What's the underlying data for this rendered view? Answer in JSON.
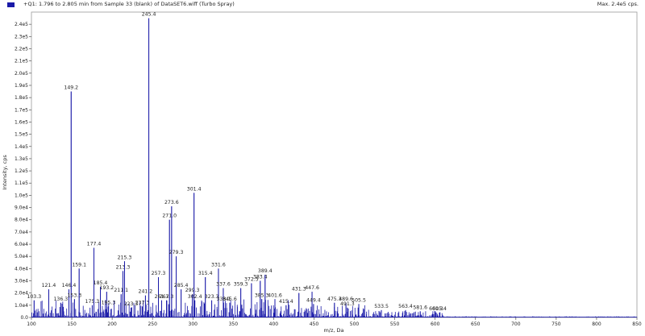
{
  "header": {
    "title": "+Q1: 1.796 to 2.805 min from Sample 33 (blank) of DataSET6.wiff (Turbo Spray)",
    "max_label": "Max. 2.4e5 cps.",
    "series_color": "#1a1aa8"
  },
  "chart_data": {
    "type": "line",
    "title": "+Q1: 1.796 to 2.805 min from Sample 33 (blank) of DataSET6.wiff (Turbo Spray)",
    "xlabel": "m/z, Da",
    "ylabel": "Intensity, cps",
    "xlim": [
      100,
      850
    ],
    "ylim": [
      0,
      250000
    ],
    "grid": false,
    "x_ticks": [
      "100",
      "150",
      "200",
      "250",
      "300",
      "350",
      "400",
      "450",
      "500",
      "550",
      "600",
      "650",
      "700",
      "750",
      "800",
      "850"
    ],
    "y_ticks": [
      {
        "value": 0,
        "label": "0.0"
      },
      {
        "value": 10000,
        "label": "1.0e4"
      },
      {
        "value": 20000,
        "label": "2.0e4"
      },
      {
        "value": 30000,
        "label": "3.0e4"
      },
      {
        "value": 40000,
        "label": "4.0e4"
      },
      {
        "value": 50000,
        "label": "5.0e4"
      },
      {
        "value": 60000,
        "label": "6.0e4"
      },
      {
        "value": 70000,
        "label": "7.0e4"
      },
      {
        "value": 80000,
        "label": "8.0e4"
      },
      {
        "value": 90000,
        "label": "9.0e4"
      },
      {
        "value": 100000,
        "label": "1.0e5"
      },
      {
        "value": 110000,
        "label": "1.1e5"
      },
      {
        "value": 120000,
        "label": "1.2e5"
      },
      {
        "value": 130000,
        "label": "1.3e5"
      },
      {
        "value": 140000,
        "label": "1.4e5"
      },
      {
        "value": 150000,
        "label": "1.5e5"
      },
      {
        "value": 160000,
        "label": "1.6e5"
      },
      {
        "value": 170000,
        "label": "1.7e5"
      },
      {
        "value": 180000,
        "label": "1.8e5"
      },
      {
        "value": 190000,
        "label": "1.9e5"
      },
      {
        "value": 200000,
        "label": "2.0e5"
      },
      {
        "value": 210000,
        "label": "2.1e5"
      },
      {
        "value": 220000,
        "label": "2.2e5"
      },
      {
        "value": 230000,
        "label": "2.3e5"
      },
      {
        "value": 240000,
        "label": "2.4e5"
      }
    ],
    "peaks": [
      {
        "x": 103.3,
        "y": 14000,
        "label": "103.3"
      },
      {
        "x": 121.4,
        "y": 23000,
        "label": "121.4"
      },
      {
        "x": 136.3,
        "y": 12000,
        "label": "136.3"
      },
      {
        "x": 146.4,
        "y": 23000,
        "label": "146.4"
      },
      {
        "x": 149.2,
        "y": 185000,
        "label": "149.2"
      },
      {
        "x": 153.3,
        "y": 15000,
        "label": "153.3"
      },
      {
        "x": 159.1,
        "y": 40000,
        "label": "159.1"
      },
      {
        "x": 175.3,
        "y": 10000,
        "label": "175.3"
      },
      {
        "x": 177.4,
        "y": 57000,
        "label": "177.4"
      },
      {
        "x": 185.4,
        "y": 25000,
        "label": "185.4"
      },
      {
        "x": 193.2,
        "y": 21000,
        "label": "193.2"
      },
      {
        "x": 195.3,
        "y": 9000,
        "label": "195.3"
      },
      {
        "x": 211.1,
        "y": 19000,
        "label": "211.1"
      },
      {
        "x": 213.3,
        "y": 38000,
        "label": "213.3"
      },
      {
        "x": 215.3,
        "y": 46000,
        "label": "215.3"
      },
      {
        "x": 223.3,
        "y": 8000,
        "label": "223.3"
      },
      {
        "x": 237.3,
        "y": 9000,
        "label": "237.3"
      },
      {
        "x": 241.2,
        "y": 18000,
        "label": "241.2"
      },
      {
        "x": 245.4,
        "y": 245000,
        "label": "245.4"
      },
      {
        "x": 257.3,
        "y": 33000,
        "label": "257.3"
      },
      {
        "x": 261.3,
        "y": 14000,
        "label": "261.3"
      },
      {
        "x": 267.3,
        "y": 14000,
        "label": "267.3"
      },
      {
        "x": 271.0,
        "y": 80000,
        "label": "271.0"
      },
      {
        "x": 273.6,
        "y": 91000,
        "label": "273.6"
      },
      {
        "x": 279.3,
        "y": 50000,
        "label": "279.3"
      },
      {
        "x": 285.4,
        "y": 23000,
        "label": "285.4"
      },
      {
        "x": 299.3,
        "y": 19000,
        "label": "299.3"
      },
      {
        "x": 301.4,
        "y": 102000,
        "label": "301.4"
      },
      {
        "x": 302.4,
        "y": 14000,
        "label": "302.4"
      },
      {
        "x": 315.4,
        "y": 33000,
        "label": "315.4"
      },
      {
        "x": 323.3,
        "y": 14000,
        "label": "323.3"
      },
      {
        "x": 331.6,
        "y": 40000,
        "label": "331.6"
      },
      {
        "x": 337.6,
        "y": 24000,
        "label": "337.6"
      },
      {
        "x": 338.1,
        "y": 12000,
        "label": "338.1"
      },
      {
        "x": 345.6,
        "y": 12000,
        "label": "345.6"
      },
      {
        "x": 359.3,
        "y": 24000,
        "label": "359.3"
      },
      {
        "x": 372.5,
        "y": 28000,
        "label": "372.5"
      },
      {
        "x": 383.4,
        "y": 30000,
        "label": "383.4"
      },
      {
        "x": 385.3,
        "y": 15000,
        "label": "385.3"
      },
      {
        "x": 389.4,
        "y": 35000,
        "label": "389.4"
      },
      {
        "x": 401.6,
        "y": 15000,
        "label": "401.6"
      },
      {
        "x": 415.4,
        "y": 10000,
        "label": "415.4"
      },
      {
        "x": 431.3,
        "y": 20000,
        "label": "431.3"
      },
      {
        "x": 447.6,
        "y": 21000,
        "label": "447.6"
      },
      {
        "x": 449.4,
        "y": 11000,
        "label": "449.4"
      },
      {
        "x": 475.3,
        "y": 12000,
        "label": "475.3"
      },
      {
        "x": 489.6,
        "y": 12000,
        "label": "489.6"
      },
      {
        "x": 491.3,
        "y": 8000,
        "label": "491.3"
      },
      {
        "x": 505.5,
        "y": 11000,
        "label": "505.5"
      },
      {
        "x": 533.5,
        "y": 6000,
        "label": "533.5"
      },
      {
        "x": 563.4,
        "y": 6000,
        "label": "563.4"
      },
      {
        "x": 581.6,
        "y": 5000,
        "label": "581.6"
      },
      {
        "x": 601.3,
        "y": 4000,
        "label": "601.3"
      },
      {
        "x": 605.4,
        "y": 4000,
        "label": "605.4"
      }
    ]
  }
}
